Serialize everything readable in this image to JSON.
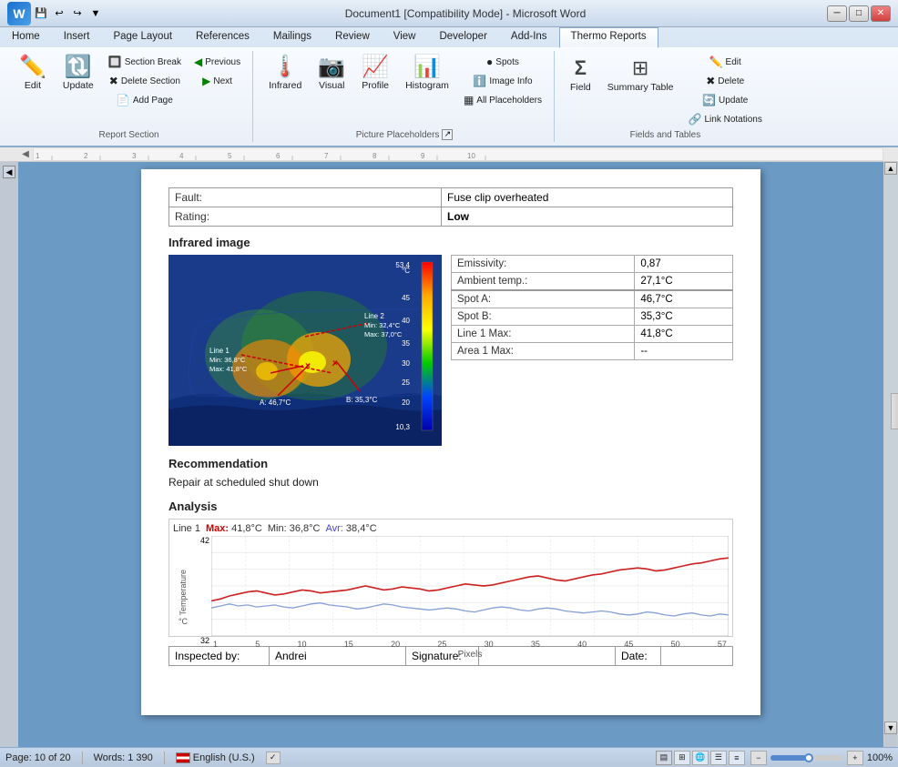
{
  "titlebar": {
    "title": "Document1 [Compatibility Mode] - Microsoft Word",
    "minimize": "─",
    "maximize": "□",
    "close": "✕"
  },
  "ribbon": {
    "tabs": [
      "Home",
      "Insert",
      "Page Layout",
      "References",
      "Mailings",
      "Review",
      "View",
      "Developer",
      "Add-Ins",
      "Thermo Reports"
    ],
    "active_tab": "Thermo Reports",
    "groups": [
      {
        "label": "Report Section",
        "buttons": [
          {
            "label": "Edit",
            "icon": "✏",
            "size": "large"
          },
          {
            "label": "Update",
            "icon": "🔄",
            "size": "large"
          },
          {
            "label": "Section Break",
            "icon": "≡",
            "size": "small"
          },
          {
            "label": "Delete Section",
            "icon": "✖",
            "size": "small"
          },
          {
            "label": "Add Page",
            "icon": "+",
            "size": "small"
          },
          {
            "label": "Previous",
            "icon": "◀",
            "size": "small"
          },
          {
            "label": "Next",
            "icon": "▶",
            "size": "small"
          }
        ]
      },
      {
        "label": "Picture Placeholders",
        "buttons": [
          {
            "label": "Infrared",
            "icon": "🌡",
            "size": "large"
          },
          {
            "label": "Visual",
            "icon": "📷",
            "size": "large"
          },
          {
            "label": "Profile",
            "icon": "📈",
            "size": "large"
          },
          {
            "label": "Histogram",
            "icon": "📊",
            "size": "large"
          },
          {
            "label": "Spots",
            "icon": "●",
            "size": "small"
          },
          {
            "label": "Image Info",
            "icon": "ℹ",
            "size": "small"
          },
          {
            "label": "All Placeholders",
            "icon": "▦",
            "size": "small"
          }
        ]
      },
      {
        "label": "Fields and Tables",
        "buttons": [
          {
            "label": "Field",
            "icon": "Σ",
            "size": "large"
          },
          {
            "label": "Summary Table",
            "icon": "⊞",
            "size": "large"
          },
          {
            "label": "Edit",
            "icon": "✏",
            "size": "small"
          },
          {
            "label": "Delete",
            "icon": "✖",
            "size": "small"
          },
          {
            "label": "Update",
            "icon": "🔄",
            "size": "small"
          },
          {
            "label": "Link Notations",
            "icon": "🔗",
            "size": "small"
          }
        ]
      }
    ]
  },
  "document": {
    "fault_label": "Fault:",
    "fault_value": "Fuse clip overheated",
    "rating_label": "Rating:",
    "rating_value": "Low",
    "infrared_section_title": "Infrared image",
    "colorbar": {
      "max": "53,4",
      "unit": "°C",
      "val45": "45",
      "val40": "40",
      "val35": "35",
      "val30": "30",
      "val25": "25",
      "val20": "20",
      "min": "10,3"
    },
    "thermal_annotations": {
      "line2_label": "Line 2",
      "line2_min": "Min: 32,4°C",
      "line2_max": "Max: 37,0°C",
      "line1_label": "Line 1",
      "line1_min": "Min: 36,8°C",
      "line1_max": "Max: 41,8°C",
      "spotA": "A: 46,7°C",
      "spotB": "B: 35,3°C"
    },
    "thermal_data": {
      "emissivity_label": "Emissivity:",
      "emissivity_value": "0,87",
      "ambient_label": "Ambient temp.:",
      "ambient_value": "27,1°C",
      "spotA_label": "Spot A:",
      "spotA_value": "46,7°C",
      "spotB_label": "Spot B:",
      "spotB_value": "35,3°C",
      "line1max_label": "Line 1 Max:",
      "line1max_value": "41,8°C",
      "area1max_label": "Area 1 Max:",
      "area1max_value": "--"
    },
    "recommendation_title": "Recommendation",
    "recommendation_text": "Repair at scheduled shut down",
    "analysis_title": "Analysis",
    "chart": {
      "line1_label": "Line 1",
      "max_label": "Max:",
      "max_value": "41,8°C",
      "min_label": "Min:",
      "min_value": "36,8°C",
      "avr_label": "Avr:",
      "avr_value": "38,4°C",
      "y_label": "Temperature",
      "y_unit": "°C",
      "x_label": "Pixels",
      "y_min": "32",
      "y_max": "42",
      "x_ticks": [
        "1",
        "5",
        "10",
        "15",
        "20",
        "25",
        "30",
        "35",
        "40",
        "45",
        "50",
        "57"
      ]
    }
  },
  "statusbar": {
    "page": "Page: 10 of 20",
    "words": "Words: 1 390",
    "language": "English (U.S.)",
    "zoom": "100%",
    "inspected_label": "Inspected by:",
    "inspected_value": "Andrei",
    "signature_label": "Signature:",
    "date_label": "Date:"
  }
}
